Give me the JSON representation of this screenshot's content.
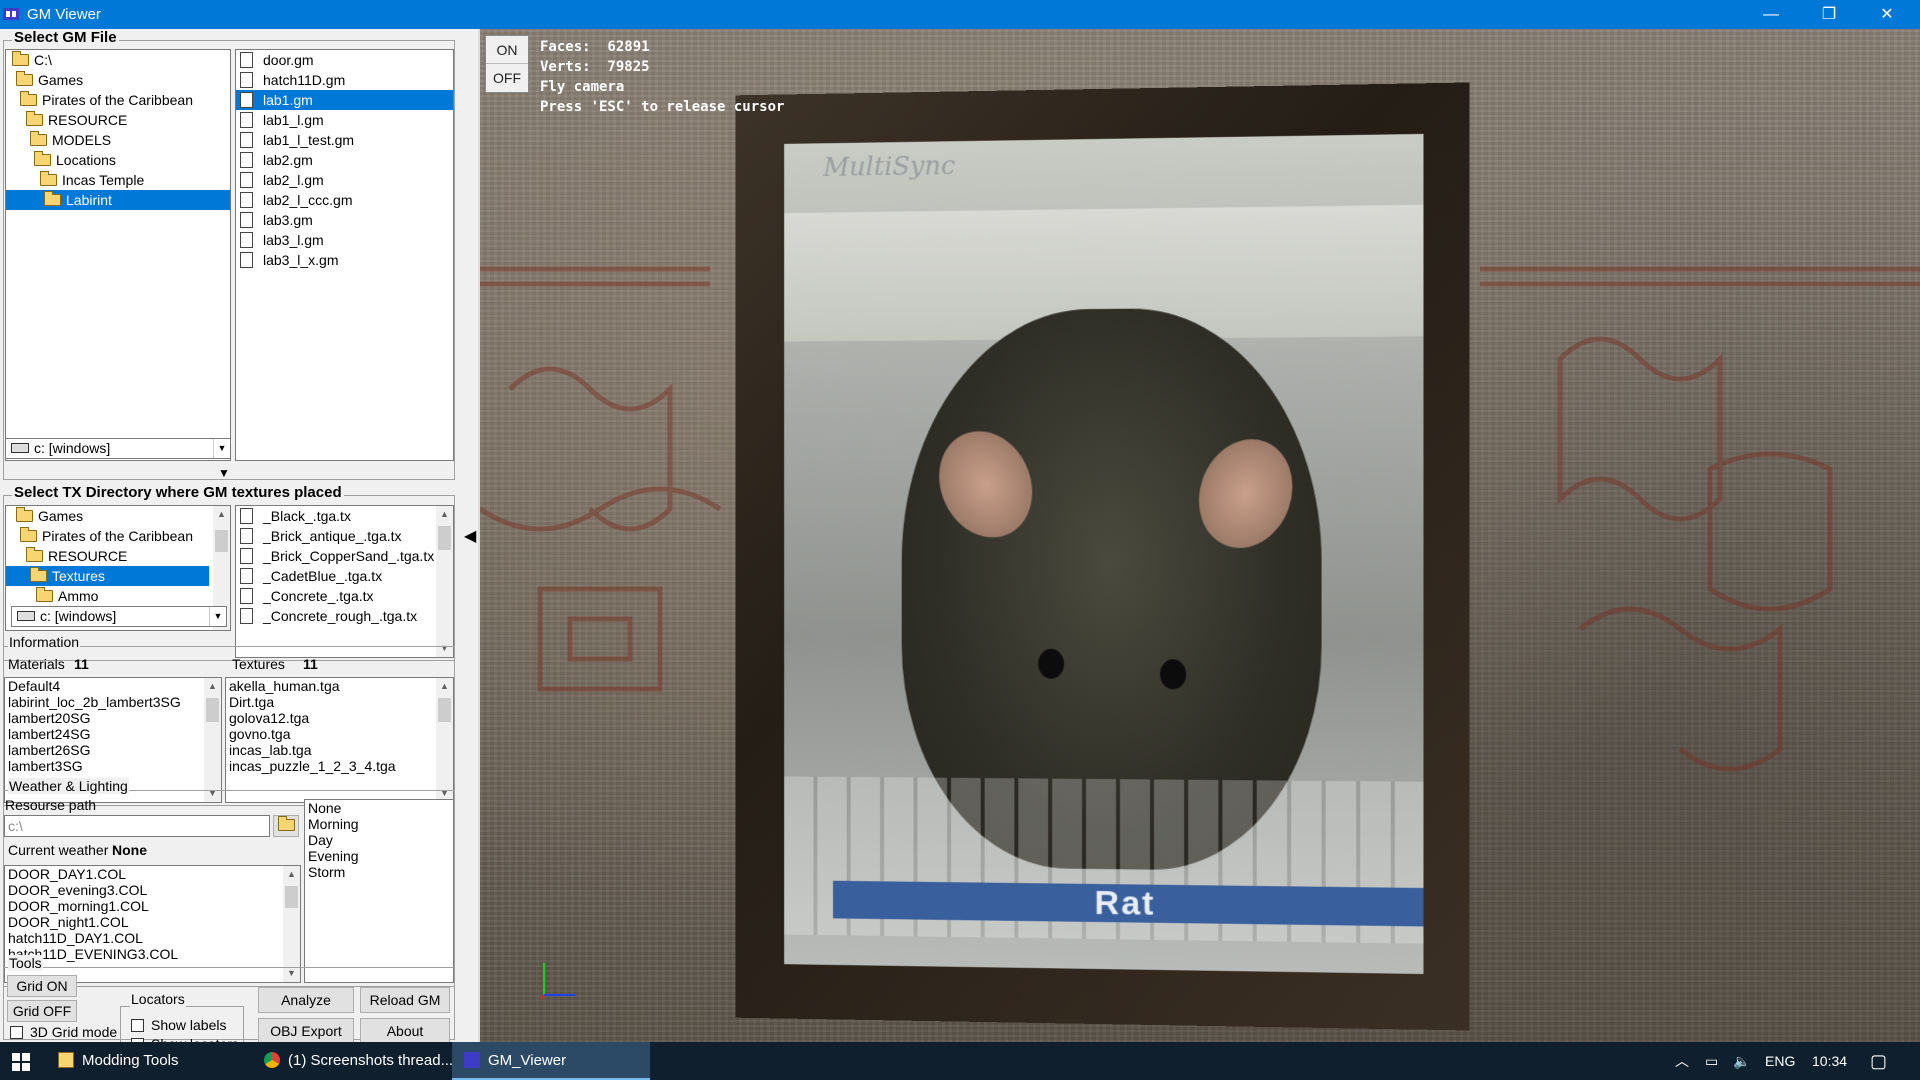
{
  "window": {
    "title": "GM Viewer",
    "minimize": "—",
    "maximize": "❐",
    "close": "✕"
  },
  "gm": {
    "section_title": "Select GM File",
    "tree": [
      "C:\\",
      "Games",
      "Pirates of the Caribbean",
      "RESOURCE",
      "MODELS",
      "Locations",
      "Incas Temple",
      "Labirint"
    ],
    "selected_tree": "Labirint",
    "files": [
      "door.gm",
      "hatch11D.gm",
      "lab1.gm",
      "lab1_l.gm",
      "lab1_l_test.gm",
      "lab2.gm",
      "lab2_l.gm",
      "lab2_l_ccc.gm",
      "lab3.gm",
      "lab3_l.gm",
      "lab3_l_x.gm"
    ],
    "selected_file": "lab1.gm",
    "drive": "c: [windows]"
  },
  "tx": {
    "section_title": "Select TX Directory where GM textures placed",
    "tree": [
      "Games",
      "Pirates of the Caribbean",
      "RESOURCE",
      "Textures",
      "Ammo"
    ],
    "selected_tree": "Textures",
    "files": [
      "_Black_.tga.tx",
      "_Brick_antique_.tga.tx",
      "_Brick_CopperSand_.tga.tx",
      "_CadetBlue_.tga.tx",
      "_Concrete_.tga.tx",
      "_Concrete_rough_.tga.tx"
    ],
    "drive": "c: [windows]"
  },
  "info": {
    "title": "Information",
    "materials_label": "Materials",
    "materials_count": "11",
    "textures_label": "Textures",
    "textures_count": "11",
    "materials": [
      "Default4",
      "labirint_loc_2b_lambert3SG",
      "lambert20SG",
      "lambert24SG",
      "lambert26SG",
      "lambert3SG"
    ],
    "textures": [
      "akella_human.tga",
      "Dirt.tga",
      "golova12.tga",
      "govno.tga",
      "incas_lab.tga",
      "incas_puzzle_1_2_3_4.tga"
    ]
  },
  "weather": {
    "title": "Weather & Lighting",
    "path_label": "Resourse path",
    "path_value": "c:\\",
    "current_label": "Current weather :",
    "current_value": "None",
    "files": [
      "DOOR_DAY1.COL",
      "DOOR_evening3.COL",
      "DOOR_morning1.COL",
      "DOOR_night1.COL",
      "hatch11D_DAY1.COL",
      "hatch11D_EVENING3.COL"
    ],
    "options": [
      "None",
      "Morning",
      "Day",
      "Evening",
      "Storm"
    ]
  },
  "tools": {
    "title": "Tools",
    "grid_on": "Grid ON",
    "grid_off": "Grid OFF",
    "grid3d": "3D Grid mode",
    "locators_title": "Locators",
    "show_labels": "Show labels",
    "show_locators": "Show locators",
    "analyze": "Analyze",
    "reload": "Reload GM",
    "obj_export": "OBJ Export",
    "about": "About"
  },
  "viewport": {
    "on": "ON",
    "off": "OFF",
    "hud": [
      "Faces:  62891",
      "Verts:  79825",
      "Fly camera",
      "Press 'ESC' to release cursor"
    ],
    "picture_caption": "Rat",
    "monitor_brand": "MultiSync"
  },
  "taskbar": {
    "items": [
      "Modding Tools",
      "(1) Screenshots thread...",
      "GM_Viewer"
    ],
    "lang": "ENG",
    "time": "10:34"
  },
  "colors": {
    "accent": "#0078d7",
    "taskbar": "#0f1f2e"
  }
}
